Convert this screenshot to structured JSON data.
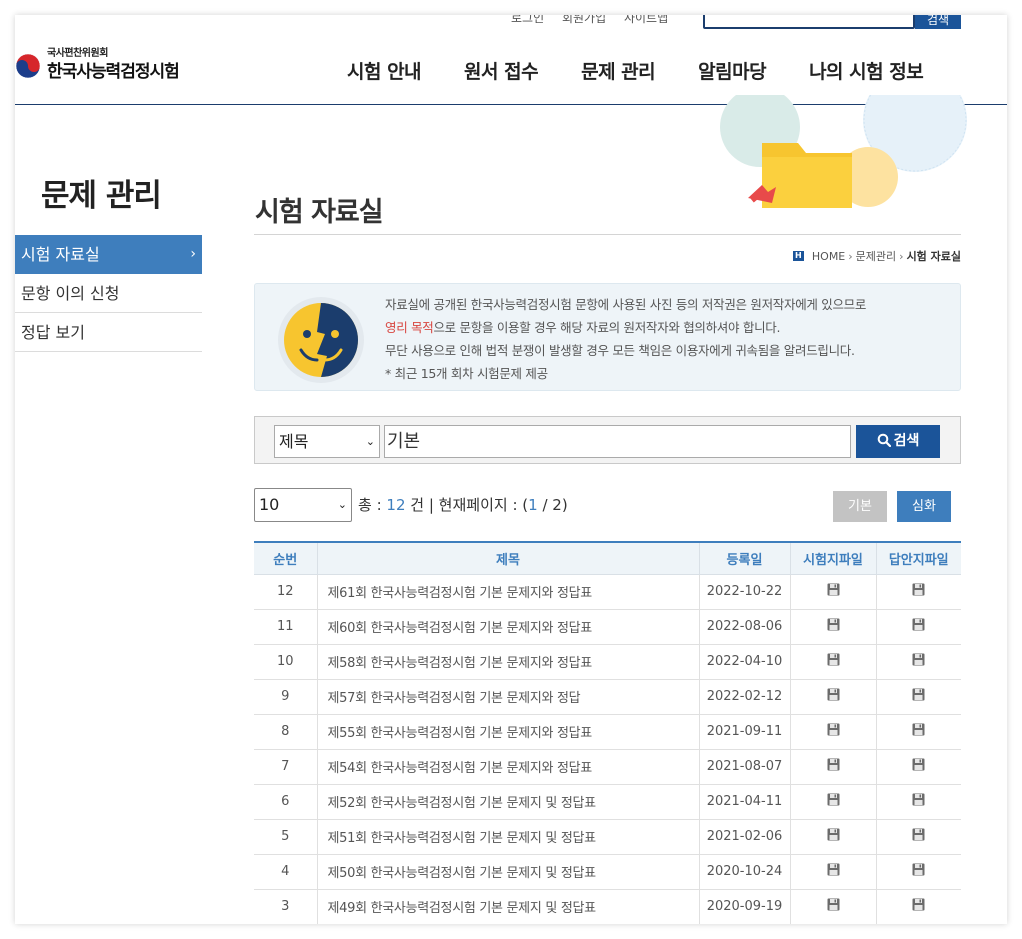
{
  "header": {
    "util_links": [
      "로그인",
      "회원가입",
      "사이트맵"
    ],
    "top_search_button": "검색",
    "logo_sub": "국사편찬위원회",
    "logo_main": "한국사능력검정시험",
    "gnb": [
      "시험 안내",
      "원서 접수",
      "문제 관리",
      "알림마당",
      "나의 시험 정보"
    ]
  },
  "sidebar": {
    "title": "문제 관리",
    "items": [
      {
        "label": "시험 자료실",
        "arrow": "›"
      },
      {
        "label": "문항 이의 신청"
      },
      {
        "label": "정답 보기"
      }
    ]
  },
  "content": {
    "title": "시험 자료실",
    "breadcrumb": {
      "home_icon": "H",
      "home": "HOME",
      "sep": "›",
      "section": "문제관리",
      "current": "시험 자료실"
    },
    "notice": {
      "line1": "자료실에 공개된 한국사능력검정시험 문항에 사용된 사진 등의 저작권은 원저작자에게 있으므로",
      "line2_highlight": "영리 목적",
      "line2_rest": "으로 문항을 이용할 경우 해당 자료의 원저작자와 협의하셔야 합니다.",
      "line3": "무단 사용으로 인해 법적 분쟁이 발생할 경우 모든 책임은 이용자에게 귀속됨을 알려드립니다.",
      "line4": "* 최근 15개 회차 시험문제 제공"
    },
    "search": {
      "field_select": "제목",
      "keyword": "기본",
      "button": "검색"
    },
    "list_info": {
      "page_size": "10",
      "total_label": "총 :",
      "total": "12",
      "unit_label": "건 | 현재페이지 : (",
      "current_page": "1",
      "page_sep": "/ 2)",
      "basic_button": "기본",
      "advanced_button": "심화"
    },
    "table": {
      "headers": [
        "순번",
        "제목",
        "등록일",
        "시험지파일",
        "답안지파일"
      ],
      "rows": [
        {
          "no": "12",
          "title": "제61회 한국사능력검정시험 기본 문제지와 정답표",
          "date": "2022-10-22"
        },
        {
          "no": "11",
          "title": "제60회 한국사능력검정시험 기본 문제지와 정답표",
          "date": "2022-08-06"
        },
        {
          "no": "10",
          "title": "제58회 한국사능력검정시험 기본 문제지와 정답표",
          "date": "2022-04-10"
        },
        {
          "no": "9",
          "title": "제57회 한국사능력검정시험 기본 문제지와 정답",
          "date": "2022-02-12"
        },
        {
          "no": "8",
          "title": "제55회 한국사능력검정시험 기본 문제지와 정답표",
          "date": "2021-09-11"
        },
        {
          "no": "7",
          "title": "제54회 한국사능력검정시험 기본 문제지와 정답표",
          "date": "2021-08-07"
        },
        {
          "no": "6",
          "title": "제52회 한국사능력검정시험 기본 문제지 및 정답표",
          "date": "2021-04-11"
        },
        {
          "no": "5",
          "title": "제51회 한국사능력검정시험 기본 문제지 및 정답표",
          "date": "2021-02-06"
        },
        {
          "no": "4",
          "title": "제50회 한국사능력검정시험 기본 문제지 및 정답표",
          "date": "2020-10-24"
        },
        {
          "no": "3",
          "title": "제49회 한국사능력검정시험 기본 문제지 및 정답표",
          "date": "2020-09-19"
        }
      ]
    }
  },
  "colors": {
    "primary": "#1b5499",
    "accent": "#3e7ebd",
    "highlight": "#d8453f",
    "notice_bg": "#eef4f8"
  },
  "icons": {
    "file": "floppy-disk-icon",
    "search": "search-icon",
    "logo": "taegeuk-emblem-icon",
    "notice": "face-icon",
    "deco": "folder-icon"
  }
}
